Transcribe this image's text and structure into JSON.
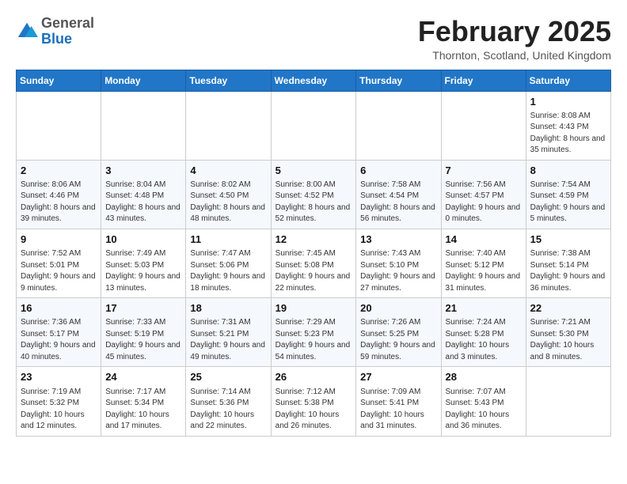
{
  "logo": {
    "general": "General",
    "blue": "Blue"
  },
  "header": {
    "month": "February 2025",
    "location": "Thornton, Scotland, United Kingdom"
  },
  "days_of_week": [
    "Sunday",
    "Monday",
    "Tuesday",
    "Wednesday",
    "Thursday",
    "Friday",
    "Saturday"
  ],
  "weeks": [
    [
      {
        "day": "",
        "info": ""
      },
      {
        "day": "",
        "info": ""
      },
      {
        "day": "",
        "info": ""
      },
      {
        "day": "",
        "info": ""
      },
      {
        "day": "",
        "info": ""
      },
      {
        "day": "",
        "info": ""
      },
      {
        "day": "1",
        "info": "Sunrise: 8:08 AM\nSunset: 4:43 PM\nDaylight: 8 hours and 35 minutes."
      }
    ],
    [
      {
        "day": "2",
        "info": "Sunrise: 8:06 AM\nSunset: 4:46 PM\nDaylight: 8 hours and 39 minutes."
      },
      {
        "day": "3",
        "info": "Sunrise: 8:04 AM\nSunset: 4:48 PM\nDaylight: 8 hours and 43 minutes."
      },
      {
        "day": "4",
        "info": "Sunrise: 8:02 AM\nSunset: 4:50 PM\nDaylight: 8 hours and 48 minutes."
      },
      {
        "day": "5",
        "info": "Sunrise: 8:00 AM\nSunset: 4:52 PM\nDaylight: 8 hours and 52 minutes."
      },
      {
        "day": "6",
        "info": "Sunrise: 7:58 AM\nSunset: 4:54 PM\nDaylight: 8 hours and 56 minutes."
      },
      {
        "day": "7",
        "info": "Sunrise: 7:56 AM\nSunset: 4:57 PM\nDaylight: 9 hours and 0 minutes."
      },
      {
        "day": "8",
        "info": "Sunrise: 7:54 AM\nSunset: 4:59 PM\nDaylight: 9 hours and 5 minutes."
      }
    ],
    [
      {
        "day": "9",
        "info": "Sunrise: 7:52 AM\nSunset: 5:01 PM\nDaylight: 9 hours and 9 minutes."
      },
      {
        "day": "10",
        "info": "Sunrise: 7:49 AM\nSunset: 5:03 PM\nDaylight: 9 hours and 13 minutes."
      },
      {
        "day": "11",
        "info": "Sunrise: 7:47 AM\nSunset: 5:06 PM\nDaylight: 9 hours and 18 minutes."
      },
      {
        "day": "12",
        "info": "Sunrise: 7:45 AM\nSunset: 5:08 PM\nDaylight: 9 hours and 22 minutes."
      },
      {
        "day": "13",
        "info": "Sunrise: 7:43 AM\nSunset: 5:10 PM\nDaylight: 9 hours and 27 minutes."
      },
      {
        "day": "14",
        "info": "Sunrise: 7:40 AM\nSunset: 5:12 PM\nDaylight: 9 hours and 31 minutes."
      },
      {
        "day": "15",
        "info": "Sunrise: 7:38 AM\nSunset: 5:14 PM\nDaylight: 9 hours and 36 minutes."
      }
    ],
    [
      {
        "day": "16",
        "info": "Sunrise: 7:36 AM\nSunset: 5:17 PM\nDaylight: 9 hours and 40 minutes."
      },
      {
        "day": "17",
        "info": "Sunrise: 7:33 AM\nSunset: 5:19 PM\nDaylight: 9 hours and 45 minutes."
      },
      {
        "day": "18",
        "info": "Sunrise: 7:31 AM\nSunset: 5:21 PM\nDaylight: 9 hours and 49 minutes."
      },
      {
        "day": "19",
        "info": "Sunrise: 7:29 AM\nSunset: 5:23 PM\nDaylight: 9 hours and 54 minutes."
      },
      {
        "day": "20",
        "info": "Sunrise: 7:26 AM\nSunset: 5:25 PM\nDaylight: 9 hours and 59 minutes."
      },
      {
        "day": "21",
        "info": "Sunrise: 7:24 AM\nSunset: 5:28 PM\nDaylight: 10 hours and 3 minutes."
      },
      {
        "day": "22",
        "info": "Sunrise: 7:21 AM\nSunset: 5:30 PM\nDaylight: 10 hours and 8 minutes."
      }
    ],
    [
      {
        "day": "23",
        "info": "Sunrise: 7:19 AM\nSunset: 5:32 PM\nDaylight: 10 hours and 12 minutes."
      },
      {
        "day": "24",
        "info": "Sunrise: 7:17 AM\nSunset: 5:34 PM\nDaylight: 10 hours and 17 minutes."
      },
      {
        "day": "25",
        "info": "Sunrise: 7:14 AM\nSunset: 5:36 PM\nDaylight: 10 hours and 22 minutes."
      },
      {
        "day": "26",
        "info": "Sunrise: 7:12 AM\nSunset: 5:38 PM\nDaylight: 10 hours and 26 minutes."
      },
      {
        "day": "27",
        "info": "Sunrise: 7:09 AM\nSunset: 5:41 PM\nDaylight: 10 hours and 31 minutes."
      },
      {
        "day": "28",
        "info": "Sunrise: 7:07 AM\nSunset: 5:43 PM\nDaylight: 10 hours and 36 minutes."
      },
      {
        "day": "",
        "info": ""
      }
    ]
  ]
}
